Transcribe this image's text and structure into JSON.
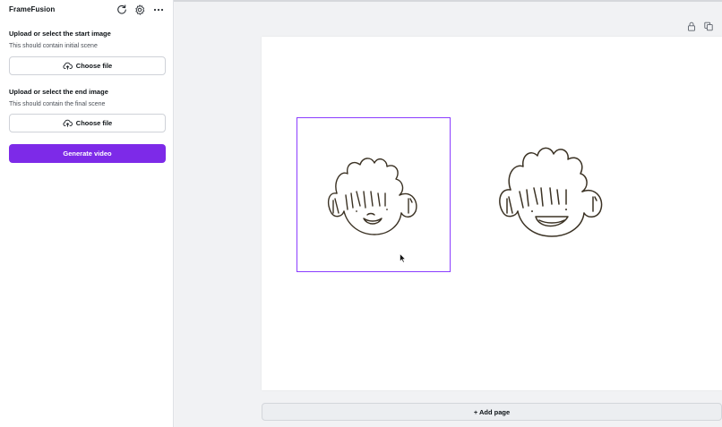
{
  "app": {
    "title": "FrameFusion"
  },
  "header_icons": [
    "refresh-icon",
    "gear-icon",
    "more-icon"
  ],
  "start_image": {
    "title": "Upload or select the start image",
    "subtitle": "This should contain initial scene",
    "button_label": "Choose file"
  },
  "end_image": {
    "title": "Upload or select the end image",
    "subtitle": "This should contain the final scene",
    "button_label": "Choose file"
  },
  "generate_label": "Generate video",
  "add_page_label": "+ Add page",
  "colors": {
    "accent": "#7d2ae8",
    "selection": "#8b3dff",
    "sketch": "#3b3224"
  }
}
